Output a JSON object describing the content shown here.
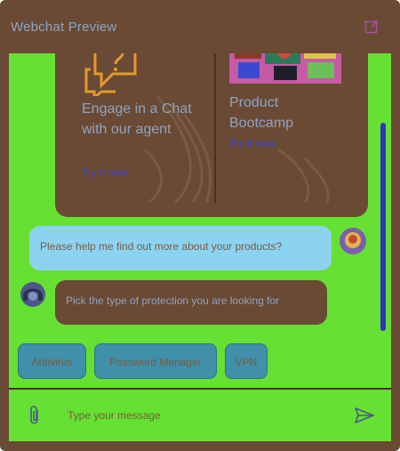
{
  "window": {
    "title": "Webchat Preview",
    "popout_icon": "popout-icon"
  },
  "carousel": {
    "cards": [
      {
        "title": "Engage in a Chat with our agent",
        "link": "Try it now",
        "icon": "question-chat-icon"
      },
      {
        "title": "Product Bootcamp",
        "link": "Try it now",
        "icon": "product-image"
      }
    ]
  },
  "messages": {
    "user": "Please help me find out more about your products?",
    "bot": "Pick the type of protection you are looking for"
  },
  "suggested_actions": [
    "Antivirus",
    "Password Manager",
    "VPN"
  ],
  "composer": {
    "placeholder": "Type your message",
    "attach_icon": "paperclip-icon",
    "send_icon": "send-icon"
  },
  "colors": {
    "window": "#6a4a35",
    "chat_background": "#66e033",
    "user_bubble": "#8cd3f2",
    "bot_bubble": "#6a4a35",
    "chip": "#3f90a8",
    "scrollbar": "#2f35b8"
  }
}
